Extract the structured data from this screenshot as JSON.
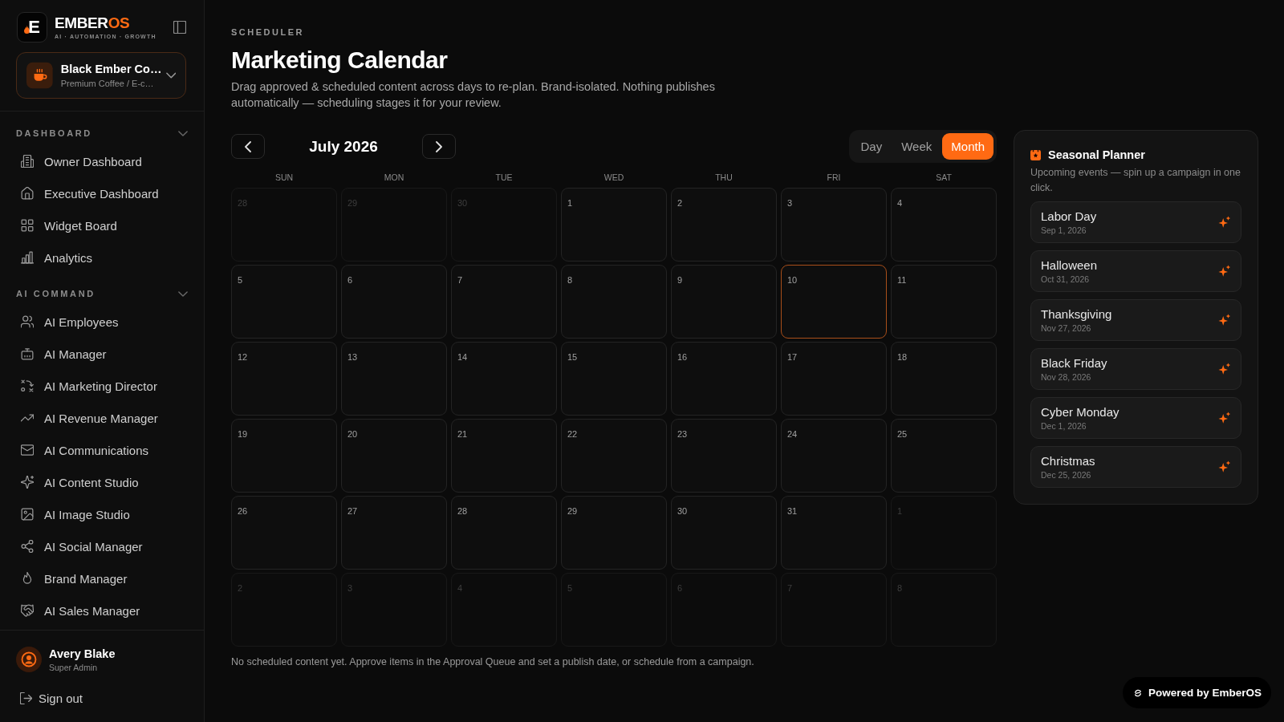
{
  "sidebar": {
    "logo": {
      "mark": "E",
      "wordmark": "EMBER",
      "wordmark_accent": "OS",
      "tagline": "AI · AUTOMATION · GROWTH"
    },
    "workspace": {
      "name": "Black Ember Co…",
      "subtitle": "Premium Coffee / E-c…"
    },
    "sections": [
      {
        "title": "DASHBOARD",
        "expanded": true,
        "items": [
          {
            "label": "Owner Dashboard",
            "selected": false
          },
          {
            "label": "Executive Dashboard",
            "selected": false
          },
          {
            "label": "Widget Board",
            "selected": false
          },
          {
            "label": "Analytics",
            "selected": false
          }
        ]
      },
      {
        "title": "AI COMMAND",
        "expanded": true,
        "items": [
          {
            "label": "AI Employees",
            "selected": false
          },
          {
            "label": "AI Manager",
            "selected": false
          },
          {
            "label": "AI Marketing Director",
            "selected": false
          },
          {
            "label": "AI Revenue Manager",
            "selected": false
          },
          {
            "label": "AI Communications",
            "selected": false
          },
          {
            "label": "AI Content Studio",
            "selected": false
          },
          {
            "label": "AI Image Studio",
            "selected": false
          },
          {
            "label": "AI Social Manager",
            "selected": false
          },
          {
            "label": "Brand Manager",
            "selected": false
          },
          {
            "label": "AI Sales Manager",
            "selected": false
          }
        ]
      }
    ],
    "user": {
      "name": "Avery Blake",
      "role": "Super Admin"
    },
    "sign_out": "Sign out"
  },
  "header": {
    "eyebrow": "SCHEDULER",
    "title": "Marketing Calendar",
    "description": "Drag approved & scheduled content across days to re-plan. Brand-isolated. Nothing publishes automatically — scheduling stages it for your review."
  },
  "calendar": {
    "month": "July 2026",
    "views": [
      {
        "label": "Day",
        "selected": false
      },
      {
        "label": "Week",
        "selected": false
      },
      {
        "label": "Month",
        "selected": true
      }
    ],
    "weekdays": [
      "SUN",
      "MON",
      "TUE",
      "WED",
      "THU",
      "FRI",
      "SAT"
    ],
    "days": [
      {
        "label": "28",
        "in_month": false,
        "today": false
      },
      {
        "label": "29",
        "in_month": false,
        "today": false
      },
      {
        "label": "30",
        "in_month": false,
        "today": false
      },
      {
        "label": "1",
        "in_month": true,
        "today": false
      },
      {
        "label": "2",
        "in_month": true,
        "today": false
      },
      {
        "label": "3",
        "in_month": true,
        "today": false
      },
      {
        "label": "4",
        "in_month": true,
        "today": false
      },
      {
        "label": "5",
        "in_month": true,
        "today": false
      },
      {
        "label": "6",
        "in_month": true,
        "today": false
      },
      {
        "label": "7",
        "in_month": true,
        "today": false
      },
      {
        "label": "8",
        "in_month": true,
        "today": false
      },
      {
        "label": "9",
        "in_month": true,
        "today": false
      },
      {
        "label": "10",
        "in_month": true,
        "today": true
      },
      {
        "label": "11",
        "in_month": true,
        "today": false
      },
      {
        "label": "12",
        "in_month": true,
        "today": false
      },
      {
        "label": "13",
        "in_month": true,
        "today": false
      },
      {
        "label": "14",
        "in_month": true,
        "today": false
      },
      {
        "label": "15",
        "in_month": true,
        "today": false
      },
      {
        "label": "16",
        "in_month": true,
        "today": false
      },
      {
        "label": "17",
        "in_month": true,
        "today": false
      },
      {
        "label": "18",
        "in_month": true,
        "today": false
      },
      {
        "label": "19",
        "in_month": true,
        "today": false
      },
      {
        "label": "20",
        "in_month": true,
        "today": false
      },
      {
        "label": "21",
        "in_month": true,
        "today": false
      },
      {
        "label": "22",
        "in_month": true,
        "today": false
      },
      {
        "label": "23",
        "in_month": true,
        "today": false
      },
      {
        "label": "24",
        "in_month": true,
        "today": false
      },
      {
        "label": "25",
        "in_month": true,
        "today": false
      },
      {
        "label": "26",
        "in_month": true,
        "today": false
      },
      {
        "label": "27",
        "in_month": true,
        "today": false
      },
      {
        "label": "28",
        "in_month": true,
        "today": false
      },
      {
        "label": "29",
        "in_month": true,
        "today": false
      },
      {
        "label": "30",
        "in_month": true,
        "today": false
      },
      {
        "label": "31",
        "in_month": true,
        "today": false
      },
      {
        "label": "1",
        "in_month": false,
        "today": false
      },
      {
        "label": "2",
        "in_month": false,
        "today": false
      },
      {
        "label": "3",
        "in_month": false,
        "today": false
      },
      {
        "label": "4",
        "in_month": false,
        "today": false
      },
      {
        "label": "5",
        "in_month": false,
        "today": false
      },
      {
        "label": "6",
        "in_month": false,
        "today": false
      },
      {
        "label": "7",
        "in_month": false,
        "today": false
      },
      {
        "label": "8",
        "in_month": false,
        "today": false
      }
    ],
    "note": "No scheduled content yet. Approve items in the Approval Queue and set a publish date, or schedule from a campaign."
  },
  "seasonal_planner": {
    "title": "Seasonal Planner",
    "subtitle": "Upcoming events — spin up a campaign in one click.",
    "events": [
      {
        "name": "Labor Day",
        "date": "Sep 1, 2026"
      },
      {
        "name": "Halloween",
        "date": "Oct 31, 2026"
      },
      {
        "name": "Thanksgiving",
        "date": "Nov 27, 2026"
      },
      {
        "name": "Black Friday",
        "date": "Nov 28, 2026"
      },
      {
        "name": "Cyber Monday",
        "date": "Dec 1, 2026"
      },
      {
        "name": "Christmas",
        "date": "Dec 25, 2026"
      }
    ]
  },
  "powered_badge": "Powered by EmberOS"
}
